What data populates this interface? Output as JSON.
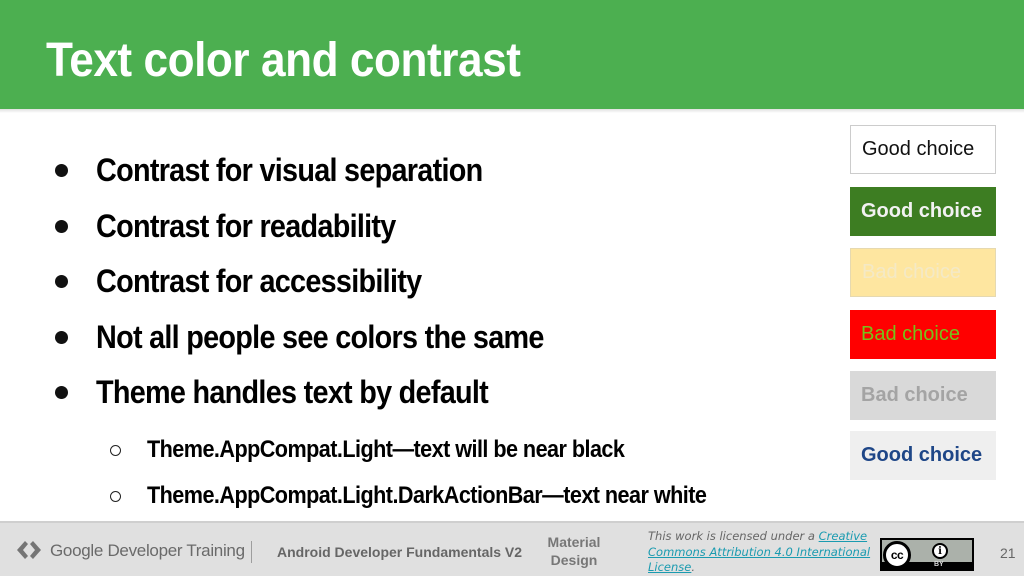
{
  "header": {
    "title": "Text color and contrast",
    "background_color": "#4caf50"
  },
  "bullets": [
    "Contrast for visual separation",
    "Contrast for readability",
    "Contrast for accessibility",
    "Not all people see colors the same",
    "Theme handles text by default"
  ],
  "sub_bullets": [
    "Theme.AppCompat.Light—text will be near black",
    "Theme.AppCompat.Light.DarkActionBar—text near white"
  ],
  "swatches": [
    {
      "label": "Good choice",
      "background": "#ffffff",
      "text_color": "#111111",
      "bold": false
    },
    {
      "label": "Good choice",
      "background": "#3d7d22",
      "text_color": "#f2f2f2",
      "bold": true
    },
    {
      "label": "Bad choice",
      "background": "#fee6a0",
      "text_color": "#f4e9c6",
      "bold": false
    },
    {
      "label": "Bad choice",
      "background": "#ff0000",
      "text_color": "#77c11a",
      "bold": false
    },
    {
      "label": "Bad choice",
      "background": "#d9d9d9",
      "text_color": "#a4a4a4",
      "bold": true
    },
    {
      "label": "Good choice",
      "background": "#efefef",
      "text_color": "#1e4687",
      "bold": true
    }
  ],
  "footer": {
    "brand_google": "Google",
    "brand_rest": " Developer Training",
    "course": "Android Developer Fundamentals V2",
    "section_line1": "Material",
    "section_line2": "Design",
    "license_prefix": "This work is licensed under a ",
    "license_link": "Creative Commons Attribution 4.0 International License",
    "license_suffix": ".",
    "cc_label": "cc",
    "by_label": "BY",
    "page_number": "21"
  },
  "icons": {
    "gdt_logo": "google-developers-chevrons-icon",
    "cc": "creative-commons-icon",
    "by": "attribution-icon"
  }
}
